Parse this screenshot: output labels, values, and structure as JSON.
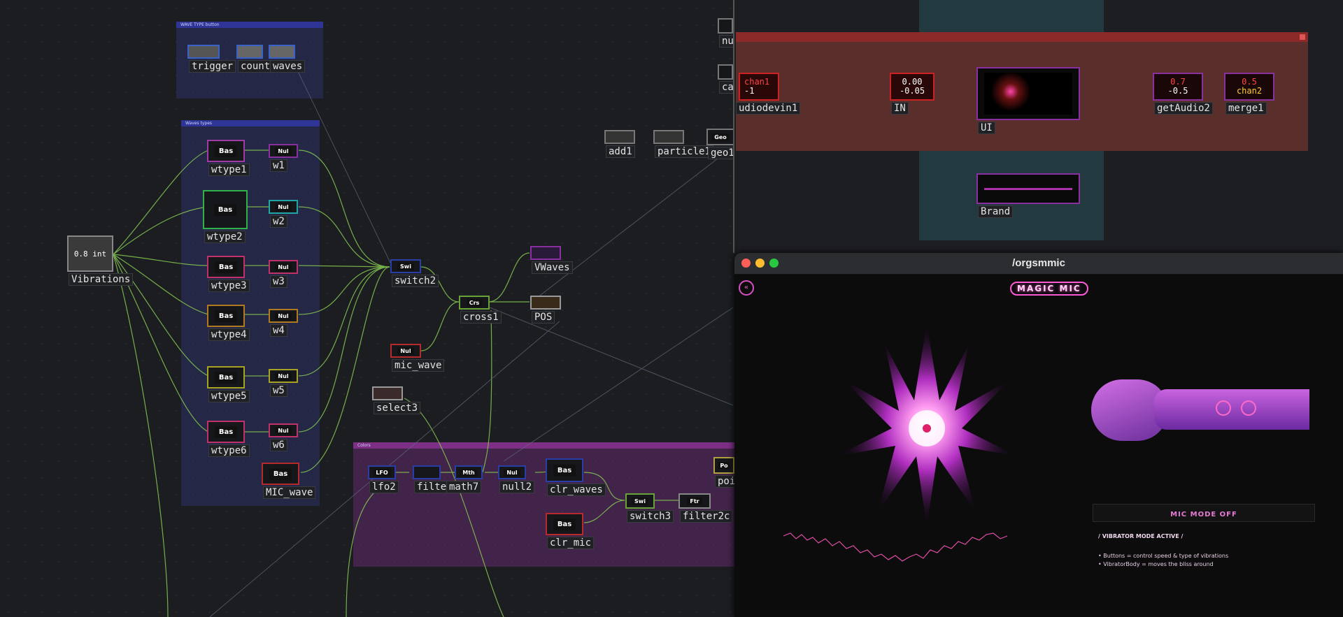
{
  "annotations": {
    "wave_type_button": "WAVE TYPE button",
    "waves_types": "Waves types",
    "colors": "Colors"
  },
  "nodes": {
    "trigger": "trigger",
    "count2": "count2",
    "waves": "waves",
    "wtype1": "wtype1",
    "wtype2": "wtype2",
    "wtype3": "wtype3",
    "wtype4": "wtype4",
    "wtype5": "wtype5",
    "wtype6": "wtype6",
    "mic_wave_big": "MIC_wave",
    "w1": "w1",
    "w2": "w2",
    "w3": "w3",
    "w4": "w4",
    "w5": "w5",
    "w6": "w6",
    "vibrations": "Vibrations",
    "vibrations_value": "0.8 int",
    "switch2": "switch2",
    "cross1": "cross1",
    "vwaves": "VWaves",
    "pos": "POS",
    "mic_wave": "mic_wave",
    "select3": "select3",
    "add1": "add1",
    "particle1": "particle1",
    "geo1": "geo1",
    "nu": "nu",
    "ca": "ca",
    "lfo2": "lfo2",
    "filter4": "filter4",
    "math7": "math7",
    "null2": "null2",
    "clr_waves": "clr_waves",
    "clr_mic": "clr_mic",
    "switch3": "switch3",
    "filter2c": "filter2c",
    "poi": "poi",
    "audiodevin1": "udiodevin1",
    "in": "IN",
    "ui": "UI",
    "getaudio2": "getAudio2",
    "merge1": "merge1",
    "brand": "Brand"
  },
  "chips": {
    "bas": "Bas",
    "nul": "Nul",
    "swi": "Swi",
    "crs": "Crs",
    "lfo": "LFO",
    "mth": "Mth",
    "ftr": "Ftr",
    "geo": "Geo",
    "po": "Po"
  },
  "values": {
    "in_a": "0.00",
    "in_b": "-0.05",
    "chan_a": "chan1",
    "chan_b": "-1",
    "get_a": "0.7",
    "get_b": "-0.5",
    "merge_a": "0.5",
    "merge_b": "chan2"
  },
  "app_window": {
    "title": "/orgsmmic",
    "logo": "MAGIC MIC",
    "mic_mode_button": "MIC MODE OFF",
    "status": "/ VIBRATOR MODE ACTIVE /",
    "help_1": "• Buttons = control speed & type of vibrations",
    "help_2": "• VibratorBody = moves the bliss around"
  },
  "colors": {
    "accent_pink": "#ff5ad6",
    "accent_purple": "#9a3cc9",
    "wire": "#7fbf4f"
  }
}
